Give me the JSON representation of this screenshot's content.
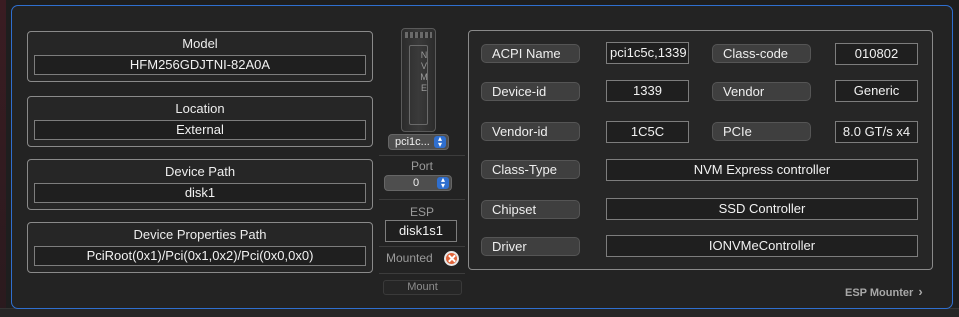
{
  "model": {
    "title": "Model",
    "value": "HFM256GDJTNI-82A0A"
  },
  "location": {
    "title": "Location",
    "value": "External"
  },
  "device_path": {
    "title": "Device Path",
    "value": "disk1"
  },
  "device_properties_path": {
    "title": "Device Properties Path",
    "value": "PciRoot(0x1)/Pci(0x1,0x2)/Pci(0x0,0x0)"
  },
  "nvme_icon_text": "NVME",
  "device_select": {
    "value": "pci1c..."
  },
  "port": {
    "label": "Port",
    "value": "0"
  },
  "esp": {
    "label": "ESP",
    "value": "disk1s1"
  },
  "mounted": {
    "label": "Mounted"
  },
  "mount_button": "Mount",
  "details": {
    "acpi_name": {
      "label": "ACPI Name",
      "value": "pci1c5c,1339"
    },
    "class_code": {
      "label": "Class-code",
      "value": "010802"
    },
    "device_id": {
      "label": "Device-id",
      "value": "1339"
    },
    "vendor": {
      "label": "Vendor",
      "value": "Generic"
    },
    "vendor_id": {
      "label": "Vendor-id",
      "value": "1C5C"
    },
    "pcie": {
      "label": "PCIe",
      "value": "8.0 GT/s x4"
    },
    "class_type": {
      "label": "Class-Type",
      "value": "NVM Express controller"
    },
    "chipset": {
      "label": "Chipset",
      "value": "SSD Controller"
    },
    "driver": {
      "label": "Driver",
      "value": "IONVMeController"
    }
  },
  "footer": {
    "esp_mounter": "ESP Mounter",
    "chevron": "›"
  },
  "colors": {
    "accent": "#2f6fcf",
    "unmounted_badge": "#e0643a"
  }
}
